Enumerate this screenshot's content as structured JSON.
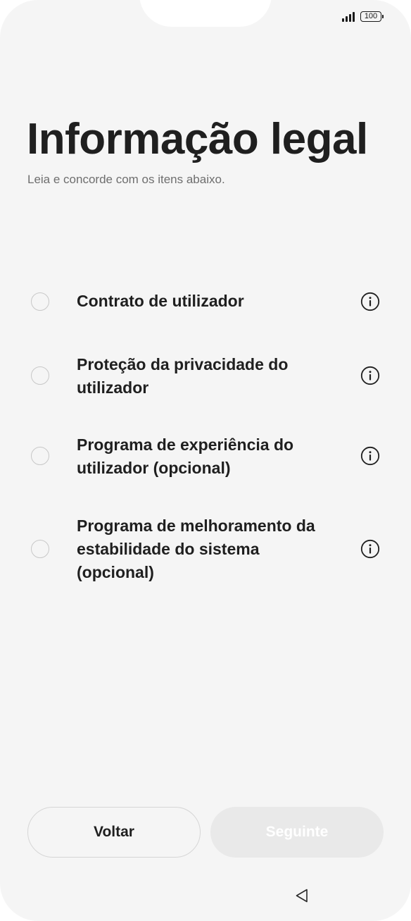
{
  "status_bar": {
    "battery_level": "100",
    "signal_icon": "signal-bars-icon",
    "battery_icon": "battery-icon"
  },
  "header": {
    "title": "Informação legal",
    "subtitle": "Leia e concorde com os itens abaixo."
  },
  "items": [
    {
      "label": "Contrato de utilizador",
      "checked": false,
      "info_icon": "info-icon"
    },
    {
      "label": "Proteção da privacidade do utilizador",
      "checked": false,
      "info_icon": "info-icon"
    },
    {
      "label": "Programa de experiência do utilizador (opcional)",
      "checked": false,
      "info_icon": "info-icon"
    },
    {
      "label": "Programa de melhoramento da estabilidade do sistema (opcional)",
      "checked": false,
      "info_icon": "info-icon"
    }
  ],
  "buttons": {
    "back_label": "Voltar",
    "next_label": "Seguinte",
    "next_enabled": false
  },
  "nav": {
    "back_icon": "triangle-back-icon"
  },
  "colors": {
    "background": "#f5f5f5",
    "text_primary": "#1f1f1f",
    "text_secondary": "#6e6e6e",
    "disabled_button": "#e9e9e9"
  }
}
